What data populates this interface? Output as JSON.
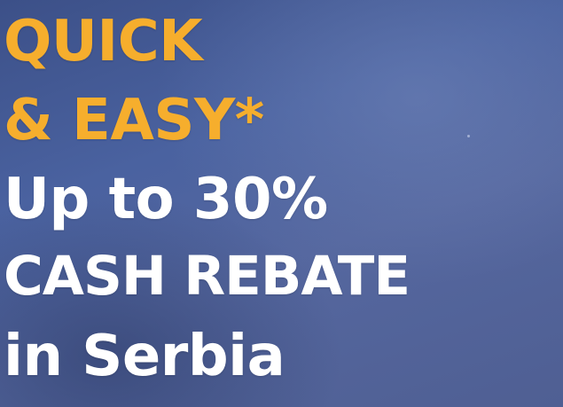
{
  "banner": {
    "headline_line1": "QUICK",
    "headline_line2": "& EASY*",
    "line3": "Up to 30%",
    "line4": "CASH REBATE",
    "line5": "in Serbia"
  },
  "colors": {
    "accent": "#f6ae2d",
    "text": "#ffffff",
    "background": "#4a62a0"
  }
}
